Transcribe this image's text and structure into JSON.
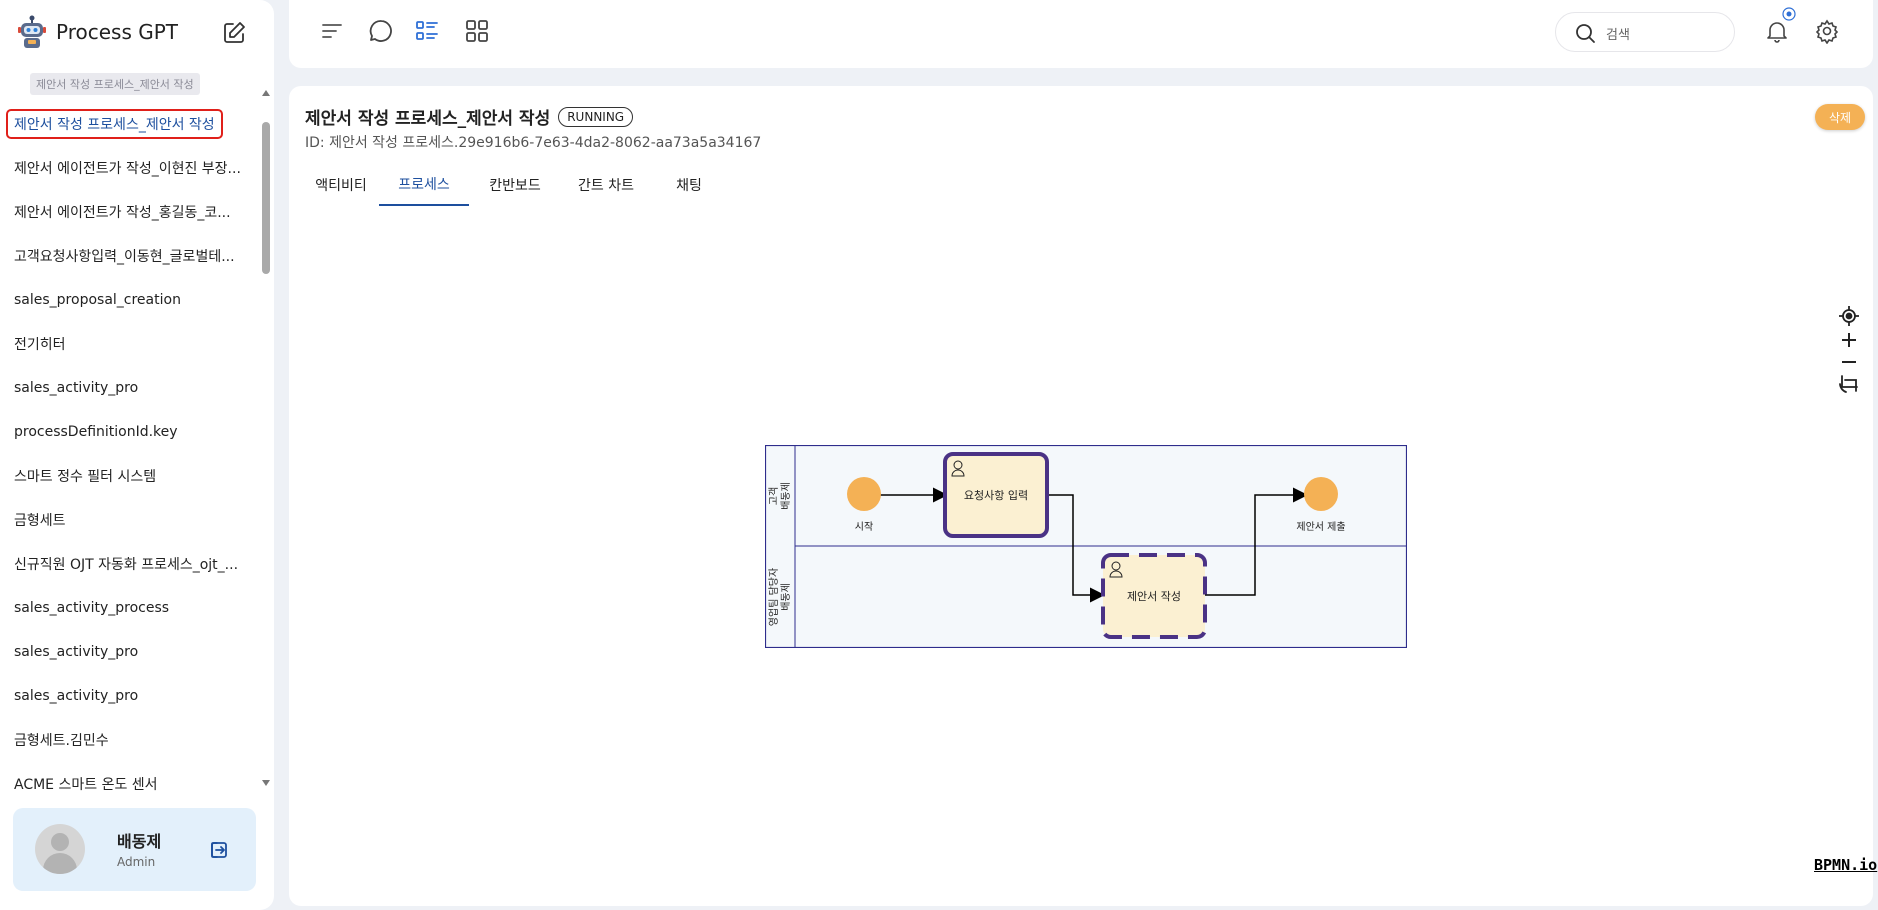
{
  "app": {
    "name": "Process GPT"
  },
  "sidebar": {
    "tooltip": "제안서 작성 프로세스_제안서 작성",
    "items": [
      {
        "label": "제안서 작성 프로세스_제안서 작성"
      },
      {
        "label": "제안서 에이전트가 작성_이현진 부장..."
      },
      {
        "label": "제안서 에이전트가 작성_홍길동_코..."
      },
      {
        "label": "고객요청사항입력_이동현_글로벌테..."
      },
      {
        "label": "sales_proposal_creation"
      },
      {
        "label": "전기히터"
      },
      {
        "label": "sales_activity_pro"
      },
      {
        "label": "processDefinitionId.key"
      },
      {
        "label": "스마트 정수 필터 시스템"
      },
      {
        "label": "금형세트"
      },
      {
        "label": "신규직원 OJT 자동화 프로세스_ojt_..."
      },
      {
        "label": "sales_activity_process"
      },
      {
        "label": "sales_activity_pro"
      },
      {
        "label": "sales_activity_pro"
      },
      {
        "label": "금형세트.김민수"
      },
      {
        "label": "ACME 스마트 온도 센서"
      }
    ]
  },
  "user": {
    "name": "배동제",
    "role": "Admin"
  },
  "topbar": {
    "search_placeholder": "검색"
  },
  "main": {
    "title": "제안서 작성 프로세스_제안서 작성",
    "status": "RUNNING",
    "id_text": "ID: 제안서 작성 프로세스.29e916b6-7e63-4da2-8062-aa73a5a34167",
    "delete_label": "삭제",
    "tabs": [
      {
        "label": "액티비티"
      },
      {
        "label": "프로세스"
      },
      {
        "label": "칸반보드"
      },
      {
        "label": "간트 차트"
      },
      {
        "label": "채팅"
      }
    ],
    "active_tab": "프로세스"
  },
  "diagram": {
    "lanes": [
      {
        "label": "고객",
        "sublabel": "배동제"
      },
      {
        "label": "영업팀 담당자",
        "sublabel": "배동제"
      }
    ],
    "start_event": "시작",
    "end_event": "제안서 제출",
    "tasks": [
      {
        "label": "요청사항 입력",
        "state": "completed"
      },
      {
        "label": "제안서 작성",
        "state": "running"
      }
    ],
    "colors": {
      "event": "#f4b155",
      "task_fill": "#fbf0d2",
      "task_border": "#4a3285",
      "lane_border": "#2e2d8c"
    }
  },
  "watermark": "BPMN.io"
}
